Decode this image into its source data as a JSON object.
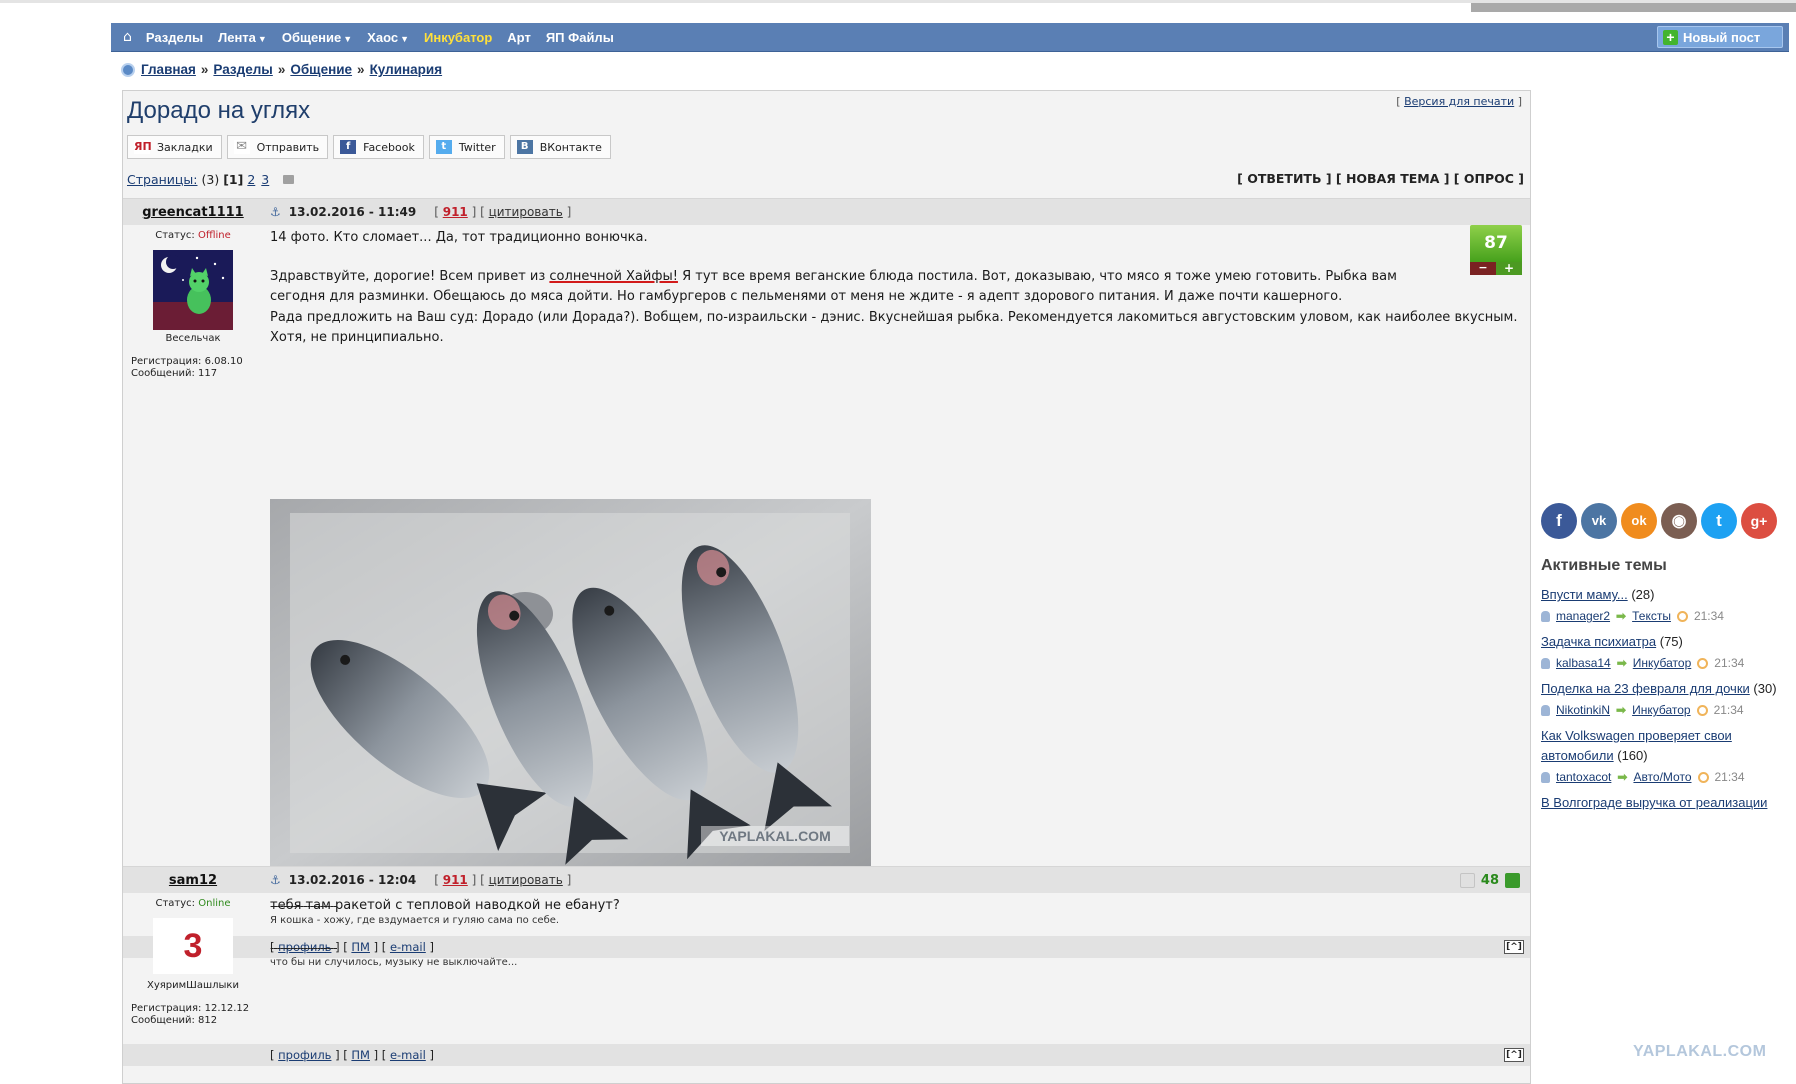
{
  "nav": {
    "home_glyph": "⌂",
    "items": [
      {
        "label": "Разделы",
        "arrow": ""
      },
      {
        "label": "Лента",
        "arrow": "▼"
      },
      {
        "label": "Общение",
        "arrow": "▼"
      },
      {
        "label": "Хаос",
        "arrow": "▼"
      },
      {
        "label": "Инкубатор",
        "arrow": ""
      },
      {
        "label": "Арт",
        "arrow": ""
      },
      {
        "label": "ЯП Файлы",
        "arrow": ""
      }
    ],
    "new_post": "Новый пост"
  },
  "breadcrumbs": [
    "Главная",
    "Разделы",
    "Общение",
    "Кулинария"
  ],
  "breadcrumb_sep": "»",
  "topic": {
    "title": "Дорадо на углях",
    "print_version": "Версия для печати"
  },
  "share": [
    {
      "label": "Закладки",
      "icon": "ЯП"
    },
    {
      "label": "Отправить",
      "icon": "✉"
    },
    {
      "label": "Facebook",
      "icon": "f"
    },
    {
      "label": "Twitter",
      "icon": "t"
    },
    {
      "label": "ВКонтакте",
      "icon": "B"
    }
  ],
  "pages": {
    "label": "Страницы:",
    "count": "(3)",
    "current": "[1]",
    "others": [
      "2",
      "3"
    ]
  },
  "actions": "[ ОТВЕТИТЬ ] [ НОВАЯ ТЕМА ] [ ОПРОС ]",
  "posts": [
    {
      "author": "greencat1111",
      "status_label": "Статус:",
      "status": "Offline",
      "nick": "Весельчак",
      "reg": "Регистрация: 6.08.10",
      "msgs": "Сообщений: 117",
      "date": "13.02.2016 - 11:49",
      "num": "911",
      "cite": "цитировать",
      "rating": "87",
      "text1": "14 фото. Кто сломает... Да, тот традиционно вонючка.",
      "text2_a": "Здравствуйте, дорогие! Всем привет из ",
      "text2_link": "солнечной Хайфы!",
      "text2_b": " Я тут все время веганские блюда постила. Вот, доказываю, что мясо я тоже умею готовить. Рыбка вам сегодня для разминки. Обещаюсь до мяса дойти. Но гамбургеров с пельменями от меня не ждите - я адепт здорового питания. И даже почти кашерного.",
      "text3": "Рада предложить на Ваш суд: Дорадо (или Дорада?). Вобщем, по-израильски - дэнис. Вкуснейшая рыбка. Рекомендуется лакомиться августовским уловом, как наиболее вкусным. Хотя, не принципиально.",
      "photo_watermark": "YAPLAKAL.COM",
      "sig_line": "--------------------",
      "signature": "Я кошка - хожу, где вздумается и гуляю сама по себе."
    },
    {
      "author": "sam12",
      "status_label": "Статус:",
      "status": "Online",
      "avatar_num": "3",
      "nick": "ХуяримШашлыки",
      "reg": "Регистрация: 12.12.12",
      "msgs": "Сообщений: 812",
      "date": "13.02.2016 - 12:04",
      "num": "911",
      "cite": "цитировать",
      "rating": "48",
      "text1": "тебя там ракетой с тепловой наводкой не ебанут?",
      "sig_line": "--------------------",
      "signature": "что бы ни случилось, музыку не выключайте..."
    }
  ],
  "footer_links": {
    "profile": "профиль",
    "pm": "ПМ",
    "email": "e-mail",
    "up": "[^]"
  },
  "sidebar": {
    "social": [
      {
        "glyph": "f",
        "color": "#3b5998"
      },
      {
        "glyph": "vk",
        "color": "#4c75a3"
      },
      {
        "glyph": "ok",
        "color": "#f08c1e"
      },
      {
        "glyph": "◉",
        "color": "#7b5e52"
      },
      {
        "glyph": "t",
        "color": "#1da1f2"
      },
      {
        "glyph": "g+",
        "color": "#dc4e41"
      }
    ],
    "title": "Активные темы",
    "topics": [
      {
        "title": "Впусти маму...",
        "count": "(28)",
        "user": "manager2",
        "section": "Тексты",
        "time": "21:34"
      },
      {
        "title": "Задачка психиатра",
        "count": "(75)",
        "user": "kalbasa14",
        "section": "Инкубатор",
        "time": "21:34"
      },
      {
        "title": "Поделка на 23 февраля для дочки",
        "count": "(30)",
        "user": "NikotinkiN",
        "section": "Инкубатор",
        "time": "21:34"
      },
      {
        "title": "Как Volkswagen проверяет свои автомобили",
        "count": "(160)",
        "user": "tantoxacot",
        "section": "Авто/Мото",
        "time": "21:34"
      },
      {
        "title": "В Волгограде выручка от реализации",
        "count": "",
        "user": "",
        "section": "",
        "time": ""
      }
    ]
  },
  "watermark": "YAPLAKAL.COM"
}
